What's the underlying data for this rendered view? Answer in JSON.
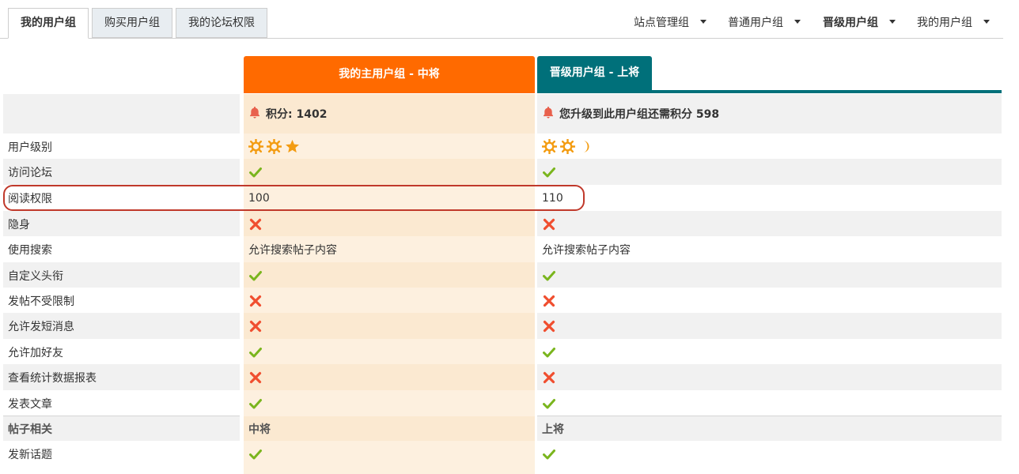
{
  "tabs": [
    {
      "label": "我的用户组",
      "active": true
    },
    {
      "label": "购买用户组",
      "active": false
    },
    {
      "label": "我的论坛权限",
      "active": false
    }
  ],
  "dropdowns": [
    {
      "label": "站点管理组",
      "bold": false
    },
    {
      "label": "普通用户组",
      "bold": false
    },
    {
      "label": "晋级用户组",
      "bold": true
    },
    {
      "label": "我的用户组",
      "bold": false
    }
  ],
  "columns": {
    "current": "我的主用户组 - 中将",
    "next": "晋级用户组 - 上将"
  },
  "points": {
    "current": "积分: 1402",
    "next": "您升级到此用户组还需积分 598"
  },
  "rows": [
    {
      "label": "用户级别",
      "current": "level",
      "next": "level"
    },
    {
      "label": "访问论坛",
      "current": "check",
      "next": "check"
    },
    {
      "label": "阅读权限",
      "current": "100",
      "next": "110"
    },
    {
      "label": "隐身",
      "current": "x",
      "next": "x"
    },
    {
      "label": "使用搜索",
      "current": "允许搜索帖子内容",
      "next": "允许搜索帖子内容"
    },
    {
      "label": "自定义头衔",
      "current": "check",
      "next": "check"
    },
    {
      "label": "发帖不受限制",
      "current": "x",
      "next": "x"
    },
    {
      "label": "允许发短消息",
      "current": "x",
      "next": "x"
    },
    {
      "label": "允许加好友",
      "current": "check",
      "next": "check"
    },
    {
      "label": "查看统计数据报表",
      "current": "x",
      "next": "x"
    },
    {
      "label": "发表文章",
      "current": "check",
      "next": "check"
    }
  ],
  "section": {
    "label": "帖子相关",
    "current": "中将",
    "next": "上将"
  },
  "section_rows": [
    {
      "label": "发新话题",
      "current": "check",
      "next": "check"
    }
  ],
  "level_icons": {
    "current": [
      "sun-icon",
      "sun-icon",
      "star-icon"
    ],
    "next": [
      "sun-icon",
      "sun-icon",
      "moon-icon"
    ]
  },
  "colors": {
    "current_header": "#ff6a00",
    "next_header": "#00707a",
    "check": "#7ab51d",
    "cross": "#f04e2f",
    "bell": "#e8604c",
    "level": "#f39c12",
    "highlight": "#c0392b"
  }
}
